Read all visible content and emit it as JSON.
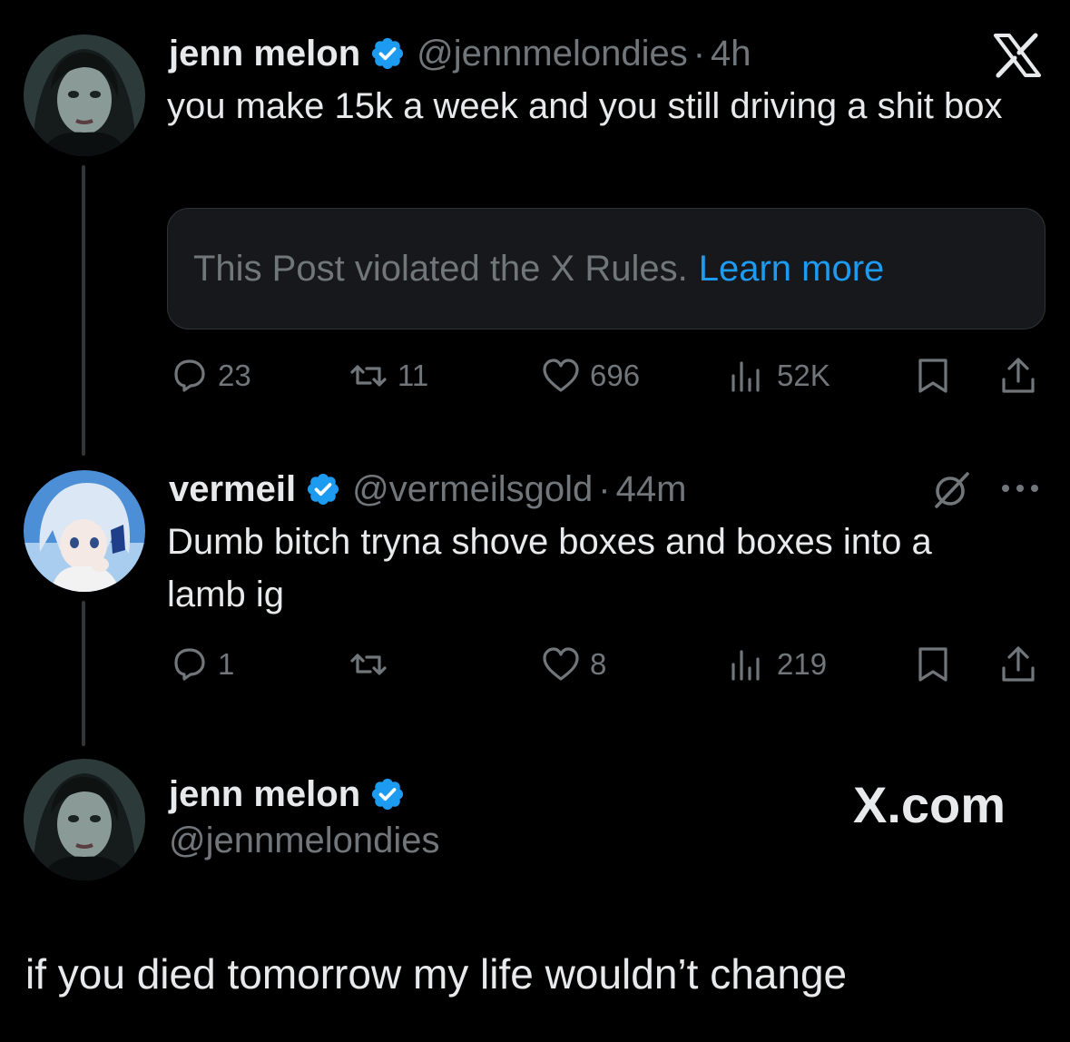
{
  "tweet1": {
    "name": "jenn melon",
    "handle": "@jennmelondies",
    "sep": "·",
    "time": "4h",
    "text": "you make 15k a week and you still driving a shit box",
    "notice": {
      "text": "This Post violated the X Rules.",
      "link": "Learn more"
    },
    "actions": {
      "replies": "23",
      "reposts": "11",
      "likes": "696",
      "views": "52K"
    },
    "logo": "X"
  },
  "tweet2": {
    "name": "vermeil",
    "handle": "@vermeilsgold",
    "sep": "·",
    "time": "44m",
    "text": "Dumb bitch tryna shove boxes and boxes into a lamb ig",
    "actions": {
      "replies": "1",
      "reposts": "",
      "likes": "8",
      "views": "219"
    }
  },
  "tweet3": {
    "name": "jenn melon",
    "handle": "@jennmelondies",
    "brand": "X.com",
    "text": "if you died tomorrow my life wouldn’t change"
  },
  "colors": {
    "background": "#000000",
    "text": "#e7e9ea",
    "muted": "#71767b",
    "link": "#1d9bf0",
    "verified": "#1d9bf0"
  },
  "icons": [
    "verified-badge-icon",
    "x-logo-icon",
    "reply-icon",
    "repost-icon",
    "like-icon",
    "views-icon",
    "bookmark-icon",
    "share-icon",
    "grok-icon",
    "more-icon"
  ]
}
